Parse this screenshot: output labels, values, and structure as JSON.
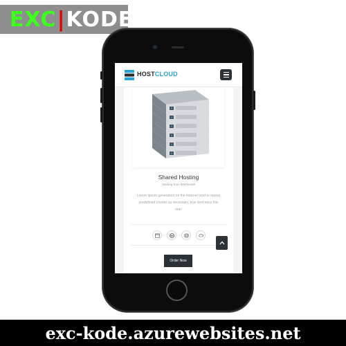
{
  "watermark": {
    "part1": "EXC",
    "separator": "|",
    "part2": "KODE"
  },
  "site": {
    "brand": {
      "host": "HOST",
      "cloud": "CLOUD",
      "icon": "server-stack-icon"
    },
    "menu": {
      "icon": "hamburger-menu-icon"
    },
    "plan": {
      "title": "Shared Hosting",
      "price": "Starting from $40/month",
      "description": "Lorem Ipsum generators on the Internet tend to repeat predefined chunks as necessary, true dont miss this one!",
      "features": [
        {
          "icon": "browser-window-icon"
        },
        {
          "icon": "wordpress-icon"
        },
        {
          "icon": "database-icon"
        },
        {
          "icon": "cloud-icon"
        }
      ],
      "order_label": "Order Now"
    },
    "scroll_top": {
      "icon": "chevron-up-icon"
    }
  },
  "footer": {
    "url": "exc-kode.azurewebsites.net"
  },
  "colors": {
    "accent": "#27a3d8",
    "dark": "#2c3136",
    "logo_green": "#3cff1c",
    "logo_red": "#e00000"
  }
}
